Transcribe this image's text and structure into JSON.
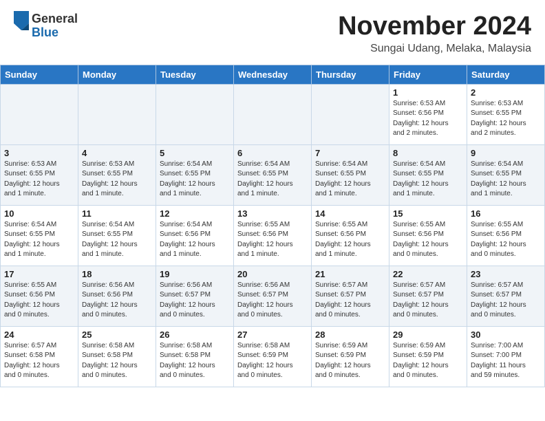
{
  "header": {
    "logo_general": "General",
    "logo_blue": "Blue",
    "month_title": "November 2024",
    "location": "Sungai Udang, Melaka, Malaysia"
  },
  "weekdays": [
    "Sunday",
    "Monday",
    "Tuesday",
    "Wednesday",
    "Thursday",
    "Friday",
    "Saturday"
  ],
  "weeks": [
    [
      {
        "day": "",
        "info": ""
      },
      {
        "day": "",
        "info": ""
      },
      {
        "day": "",
        "info": ""
      },
      {
        "day": "",
        "info": ""
      },
      {
        "day": "",
        "info": ""
      },
      {
        "day": "1",
        "info": "Sunrise: 6:53 AM\nSunset: 6:56 PM\nDaylight: 12 hours\nand 2 minutes."
      },
      {
        "day": "2",
        "info": "Sunrise: 6:53 AM\nSunset: 6:55 PM\nDaylight: 12 hours\nand 2 minutes."
      }
    ],
    [
      {
        "day": "3",
        "info": "Sunrise: 6:53 AM\nSunset: 6:55 PM\nDaylight: 12 hours\nand 1 minute."
      },
      {
        "day": "4",
        "info": "Sunrise: 6:53 AM\nSunset: 6:55 PM\nDaylight: 12 hours\nand 1 minute."
      },
      {
        "day": "5",
        "info": "Sunrise: 6:54 AM\nSunset: 6:55 PM\nDaylight: 12 hours\nand 1 minute."
      },
      {
        "day": "6",
        "info": "Sunrise: 6:54 AM\nSunset: 6:55 PM\nDaylight: 12 hours\nand 1 minute."
      },
      {
        "day": "7",
        "info": "Sunrise: 6:54 AM\nSunset: 6:55 PM\nDaylight: 12 hours\nand 1 minute."
      },
      {
        "day": "8",
        "info": "Sunrise: 6:54 AM\nSunset: 6:55 PM\nDaylight: 12 hours\nand 1 minute."
      },
      {
        "day": "9",
        "info": "Sunrise: 6:54 AM\nSunset: 6:55 PM\nDaylight: 12 hours\nand 1 minute."
      }
    ],
    [
      {
        "day": "10",
        "info": "Sunrise: 6:54 AM\nSunset: 6:55 PM\nDaylight: 12 hours\nand 1 minute."
      },
      {
        "day": "11",
        "info": "Sunrise: 6:54 AM\nSunset: 6:55 PM\nDaylight: 12 hours\nand 1 minute."
      },
      {
        "day": "12",
        "info": "Sunrise: 6:54 AM\nSunset: 6:56 PM\nDaylight: 12 hours\nand 1 minute."
      },
      {
        "day": "13",
        "info": "Sunrise: 6:55 AM\nSunset: 6:56 PM\nDaylight: 12 hours\nand 1 minute."
      },
      {
        "day": "14",
        "info": "Sunrise: 6:55 AM\nSunset: 6:56 PM\nDaylight: 12 hours\nand 1 minute."
      },
      {
        "day": "15",
        "info": "Sunrise: 6:55 AM\nSunset: 6:56 PM\nDaylight: 12 hours\nand 0 minutes."
      },
      {
        "day": "16",
        "info": "Sunrise: 6:55 AM\nSunset: 6:56 PM\nDaylight: 12 hours\nand 0 minutes."
      }
    ],
    [
      {
        "day": "17",
        "info": "Sunrise: 6:55 AM\nSunset: 6:56 PM\nDaylight: 12 hours\nand 0 minutes."
      },
      {
        "day": "18",
        "info": "Sunrise: 6:56 AM\nSunset: 6:56 PM\nDaylight: 12 hours\nand 0 minutes."
      },
      {
        "day": "19",
        "info": "Sunrise: 6:56 AM\nSunset: 6:57 PM\nDaylight: 12 hours\nand 0 minutes."
      },
      {
        "day": "20",
        "info": "Sunrise: 6:56 AM\nSunset: 6:57 PM\nDaylight: 12 hours\nand 0 minutes."
      },
      {
        "day": "21",
        "info": "Sunrise: 6:57 AM\nSunset: 6:57 PM\nDaylight: 12 hours\nand 0 minutes."
      },
      {
        "day": "22",
        "info": "Sunrise: 6:57 AM\nSunset: 6:57 PM\nDaylight: 12 hours\nand 0 minutes."
      },
      {
        "day": "23",
        "info": "Sunrise: 6:57 AM\nSunset: 6:57 PM\nDaylight: 12 hours\nand 0 minutes."
      }
    ],
    [
      {
        "day": "24",
        "info": "Sunrise: 6:57 AM\nSunset: 6:58 PM\nDaylight: 12 hours\nand 0 minutes."
      },
      {
        "day": "25",
        "info": "Sunrise: 6:58 AM\nSunset: 6:58 PM\nDaylight: 12 hours\nand 0 minutes."
      },
      {
        "day": "26",
        "info": "Sunrise: 6:58 AM\nSunset: 6:58 PM\nDaylight: 12 hours\nand 0 minutes."
      },
      {
        "day": "27",
        "info": "Sunrise: 6:58 AM\nSunset: 6:59 PM\nDaylight: 12 hours\nand 0 minutes."
      },
      {
        "day": "28",
        "info": "Sunrise: 6:59 AM\nSunset: 6:59 PM\nDaylight: 12 hours\nand 0 minutes."
      },
      {
        "day": "29",
        "info": "Sunrise: 6:59 AM\nSunset: 6:59 PM\nDaylight: 12 hours\nand 0 minutes."
      },
      {
        "day": "30",
        "info": "Sunrise: 7:00 AM\nSunset: 7:00 PM\nDaylight: 11 hours\nand 59 minutes."
      }
    ]
  ]
}
